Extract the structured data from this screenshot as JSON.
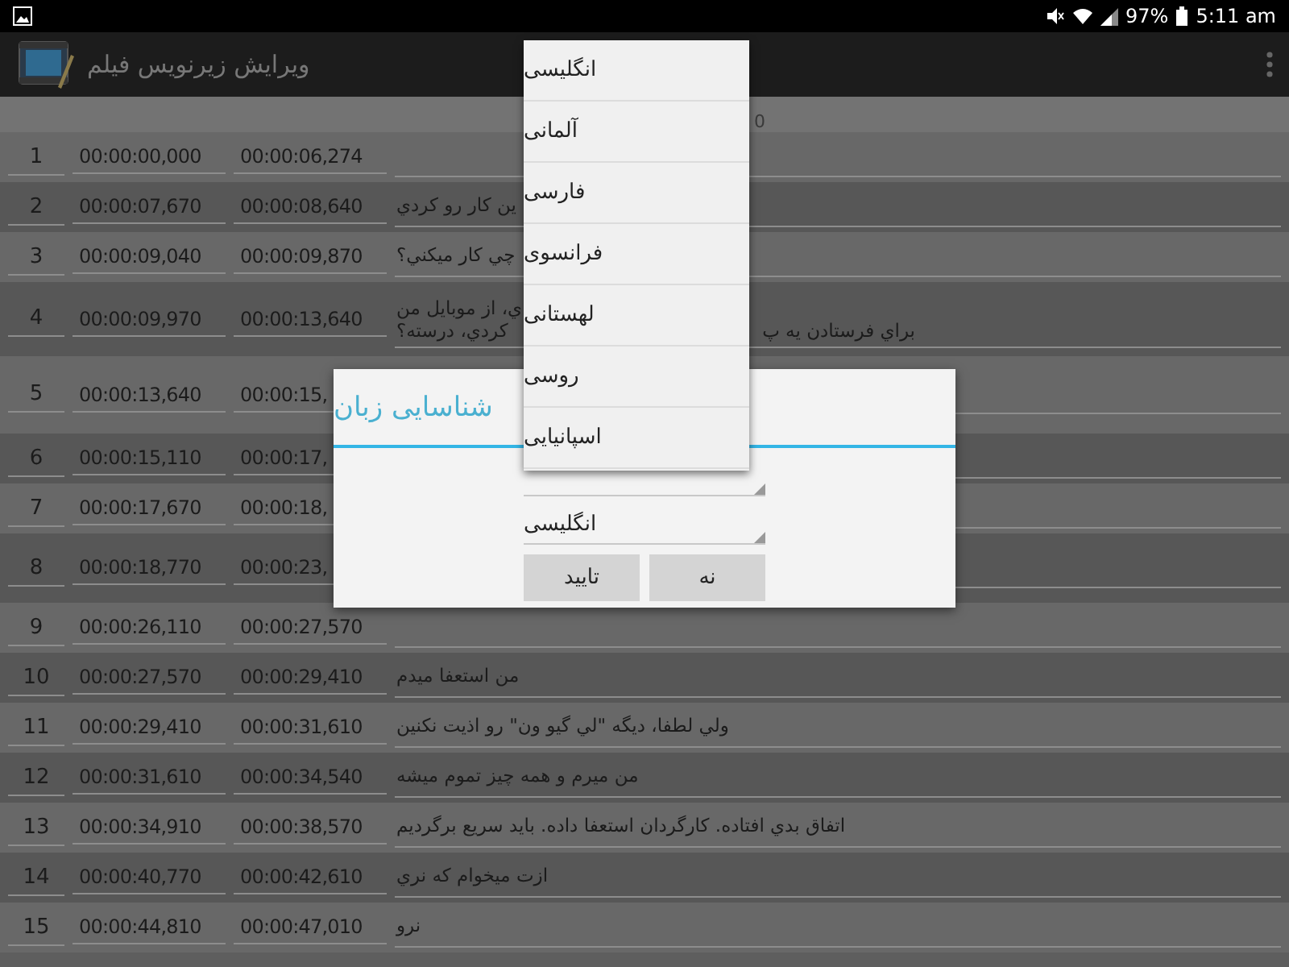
{
  "status_bar": {
    "battery": "97%",
    "time": "5:11 am"
  },
  "app_bar": {
    "title": "ویرایش زیرنویس فیلم"
  },
  "table": {
    "header": "0",
    "rows": [
      {
        "number": "1",
        "start": "00:00:00,000",
        "end": "00:00:06,274"
      },
      {
        "number": "2",
        "start": "00:00:07,670",
        "end": "00:00:08,640",
        "text_lines": [
          [
            "ين كار رو كردي"
          ]
        ]
      },
      {
        "number": "3",
        "start": "00:00:09,040",
        "end": "00:00:09,870",
        "text_lines": [
          [
            "چي كار ميكني؟"
          ]
        ]
      },
      {
        "number": "4",
        "start": "00:00:09,970",
        "end": "00:00:13,640",
        "text_lines": [
          [
            "ي، از موبايل من"
          ],
          [
            "براي فرستادن يه پ",
            "كردي، درسته؟"
          ]
        ]
      },
      {
        "number": "5",
        "start": "00:00:13,640",
        "end": "00:00:15,"
      },
      {
        "number": "6",
        "start": "00:00:15,110",
        "end": "00:00:17,"
      },
      {
        "number": "7",
        "start": "00:00:17,670",
        "end": "00:00:18,"
      },
      {
        "number": "8",
        "start": "00:00:18,770",
        "end": "00:00:23,"
      },
      {
        "number": "9",
        "start": "00:00:26,110",
        "end": "00:00:27,570"
      },
      {
        "number": "10",
        "start": "00:00:27,570",
        "end": "00:00:29,410",
        "text_lines": [
          [
            "من استعفا ميدم"
          ]
        ]
      },
      {
        "number": "11",
        "start": "00:00:29,410",
        "end": "00:00:31,610",
        "text_lines": [
          [
            "ولي لطفا، ديگه \"لي گيو ون\" رو اذيت نكنين"
          ]
        ]
      },
      {
        "number": "12",
        "start": "00:00:31,610",
        "end": "00:00:34,540",
        "text_lines": [
          [
            "من ميرم و همه چيز تموم ميشه"
          ]
        ]
      },
      {
        "number": "13",
        "start": "00:00:34,910",
        "end": "00:00:38,570",
        "text_lines": [
          [
            "اتفاق بدي افتاده. كارگردان استعفا داده. بايد سريع برگرديم"
          ]
        ]
      },
      {
        "number": "14",
        "start": "00:00:40,770",
        "end": "00:00:42,610",
        "text_lines": [
          [
            "ازت ميخوام كه نري"
          ]
        ]
      },
      {
        "number": "15",
        "start": "00:00:44,810",
        "end": "00:00:47,010",
        "text_lines": [
          [
            "نرو"
          ]
        ]
      }
    ]
  },
  "dialog": {
    "title": "شناسایی زبان",
    "language": "انگلیسی",
    "buttons": [
      "نه",
      "تایید"
    ]
  },
  "dropdown": {
    "options": [
      "انگلیسی",
      "آلمانی",
      "فارسی",
      "فرانسوی",
      "لهستانی",
      "روسی",
      "اسپانیایی"
    ]
  }
}
